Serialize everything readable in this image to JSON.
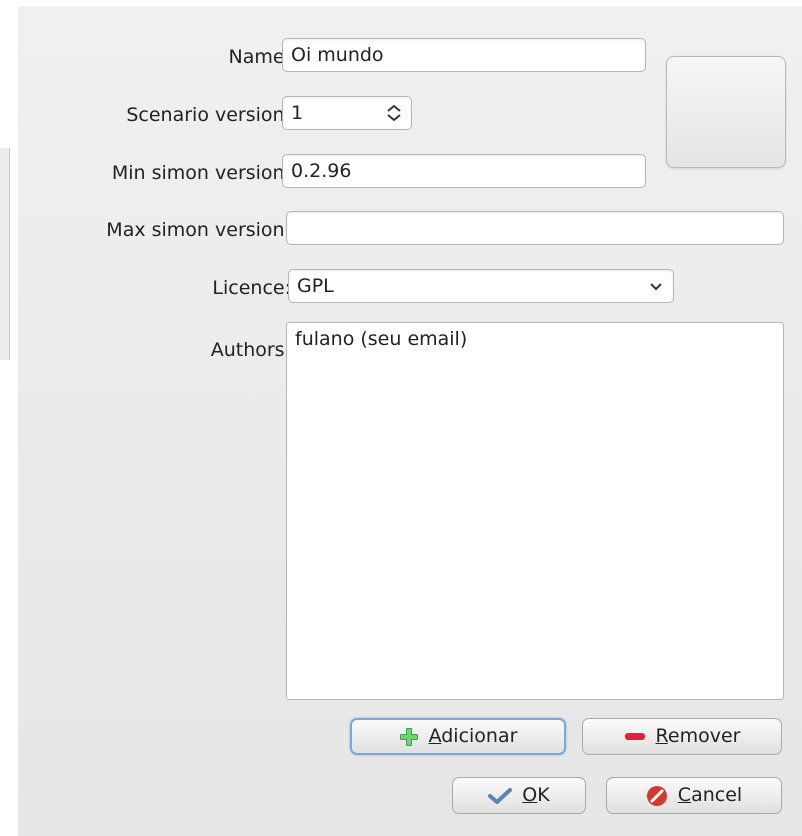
{
  "form": {
    "name_label": "Name:",
    "name_value": "Oi mundo",
    "scenario_version_label": "Scenario version:",
    "scenario_version_value": "1",
    "min_version_label": "Min simon version:",
    "min_version_value": "0.2.96",
    "max_version_label": "Max simon version:",
    "max_version_value": "",
    "licence_label": "Licence:",
    "licence_value": "GPL",
    "authors_label": "Authors:",
    "authors_value": "fulano (seu email)"
  },
  "author_buttons": {
    "add_mnemonic": "A",
    "add_rest": "dicionar",
    "remove_mnemonic": "R",
    "remove_rest": "emover"
  },
  "dialog_buttons": {
    "ok_mnemonic": "O",
    "ok_rest": "K",
    "cancel_mnemonic": "C",
    "cancel_rest": "ancel"
  },
  "icons": {
    "add": "plus-icon",
    "remove": "minus-icon",
    "ok": "checkmark-icon",
    "cancel": "cancel-icon",
    "spin": "spin-arrows-icon",
    "dropdown": "chevron-down-icon"
  },
  "colors": {
    "add_icon": "#3aa83a",
    "remove_icon": "#e0213a",
    "ok_icon": "#5b84b5",
    "cancel_icon": "#d23a2e",
    "focus_border": "#7aa9d8"
  }
}
